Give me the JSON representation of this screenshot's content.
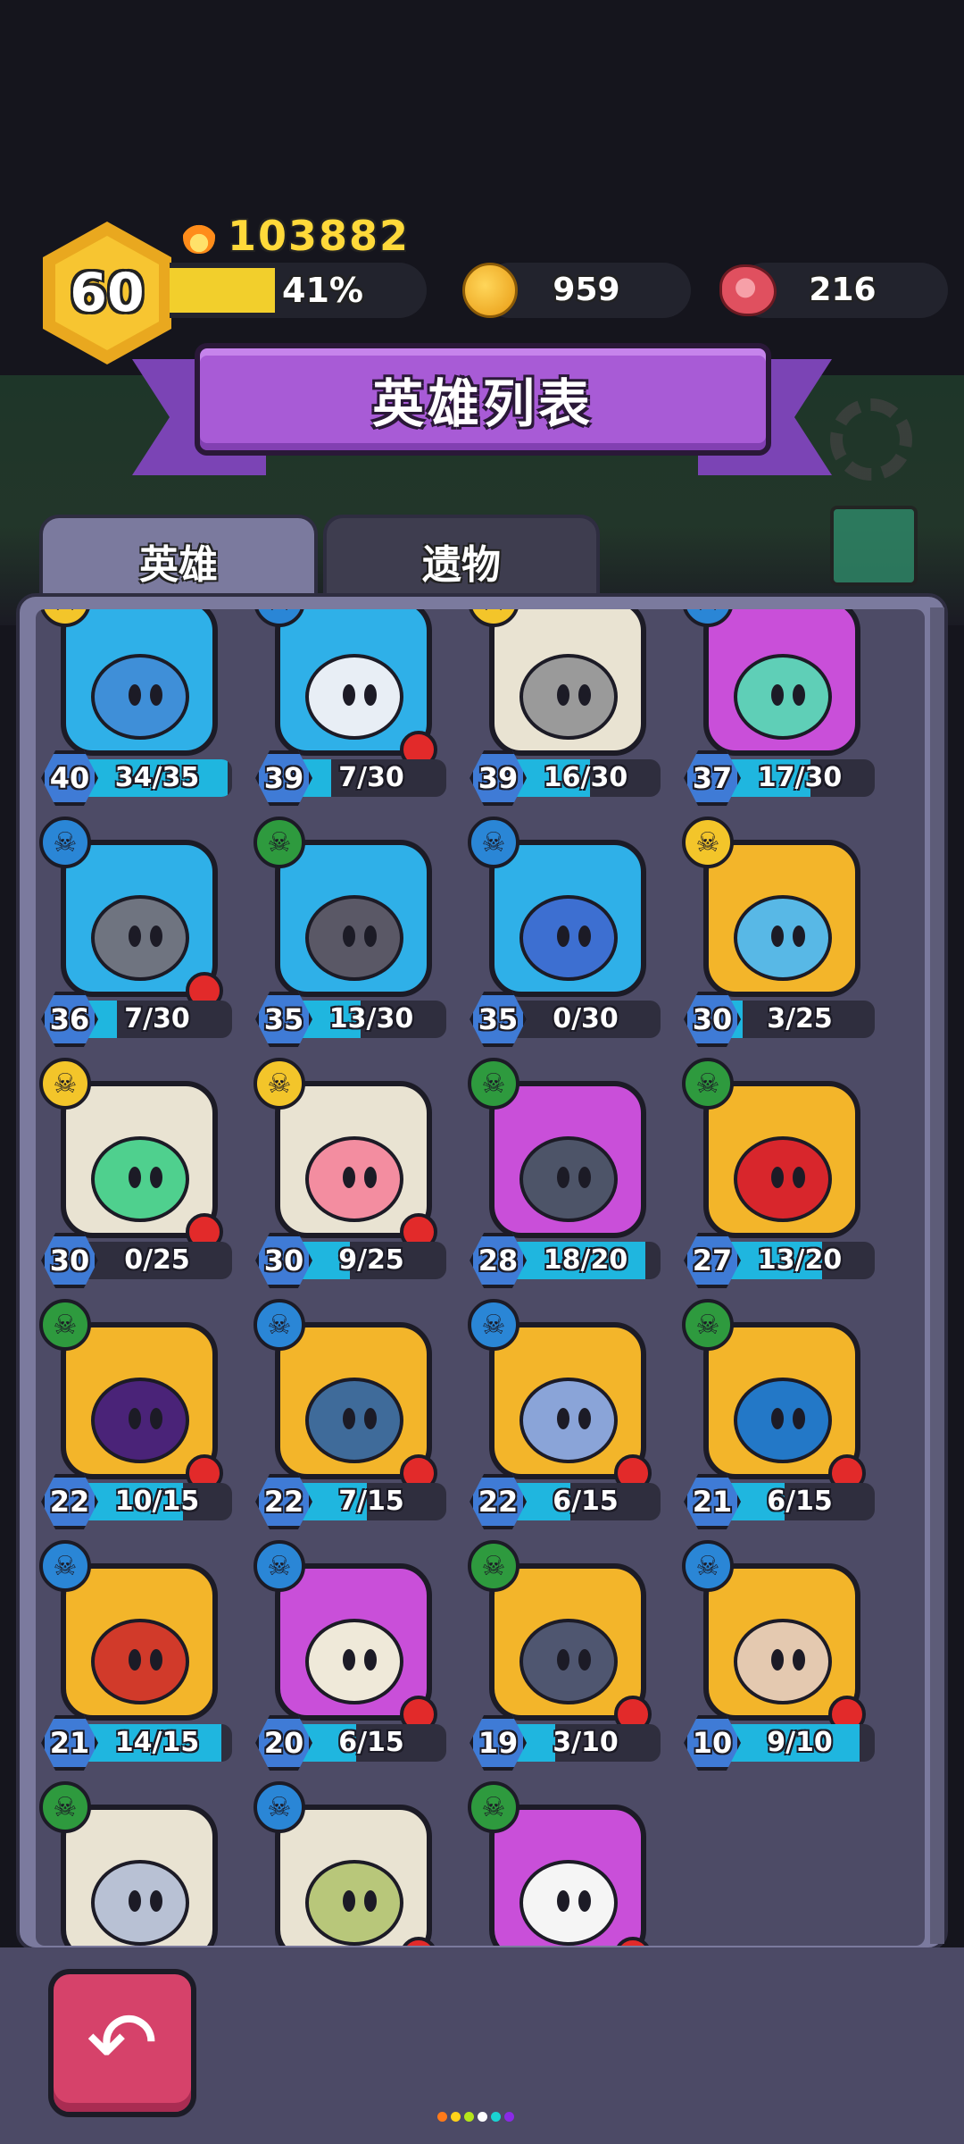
{
  "player": {
    "level": "60",
    "power": "103882",
    "xp_percent_label": "41%",
    "xp_fraction": 0.41
  },
  "resources": {
    "gold": "959",
    "meat": "216"
  },
  "title": "英雄列表",
  "tabs": [
    {
      "label": "英雄",
      "active": true
    },
    {
      "label": "遗物",
      "active": false
    }
  ],
  "heroes": [
    {
      "level": "40",
      "progress": "34/35",
      "fill": 0.97,
      "bg": "#2fb0e8",
      "face": "#3f8fd8",
      "badge": "crossbones",
      "new": false
    },
    {
      "level": "39",
      "progress": "7/30",
      "fill": 0.23,
      "bg": "#2fb0e8",
      "face": "#e8eef5",
      "badge": "blue",
      "new": true
    },
    {
      "level": "39",
      "progress": "16/30",
      "fill": 0.53,
      "bg": "#e9e3d2",
      "face": "#9a9a9a",
      "badge": "crossbones",
      "new": false
    },
    {
      "level": "37",
      "progress": "17/30",
      "fill": 0.57,
      "bg": "#c94fd9",
      "face": "#5fcfb7",
      "badge": "blue",
      "new": false
    },
    {
      "level": "36",
      "progress": "7/30",
      "fill": 0.23,
      "bg": "#2fb0e8",
      "face": "#6f7480",
      "badge": "blue",
      "new": true
    },
    {
      "level": "35",
      "progress": "13/30",
      "fill": 0.43,
      "bg": "#2fb0e8",
      "face": "#5a5866",
      "badge": "green",
      "new": false
    },
    {
      "level": "35",
      "progress": "0/30",
      "fill": 0.0,
      "bg": "#2fb0e8",
      "face": "#3d6fd1",
      "badge": "blue",
      "new": false
    },
    {
      "level": "30",
      "progress": "3/25",
      "fill": 0.12,
      "bg": "#f3b52a",
      "face": "#58b8e6",
      "badge": "crossbones",
      "new": false
    },
    {
      "level": "30",
      "progress": "0/25",
      "fill": 0.0,
      "bg": "#e9e3d2",
      "face": "#4fd08e",
      "badge": "crossbones",
      "new": true
    },
    {
      "level": "30",
      "progress": "9/25",
      "fill": 0.36,
      "bg": "#e9e3d2",
      "face": "#f38da0",
      "badge": "crossbones",
      "new": true
    },
    {
      "level": "28",
      "progress": "18/20",
      "fill": 0.9,
      "bg": "#c94fd9",
      "face": "#4d5468",
      "badge": "green",
      "new": false
    },
    {
      "level": "27",
      "progress": "13/20",
      "fill": 0.65,
      "bg": "#f3b52a",
      "face": "#d8262c",
      "badge": "green",
      "new": false
    },
    {
      "level": "22",
      "progress": "10/15",
      "fill": 0.67,
      "bg": "#f3b52a",
      "face": "#4a2378",
      "badge": "green",
      "new": true
    },
    {
      "level": "22",
      "progress": "7/15",
      "fill": 0.47,
      "bg": "#f3b52a",
      "face": "#3f6b9a",
      "badge": "blue",
      "new": true
    },
    {
      "level": "22",
      "progress": "6/15",
      "fill": 0.4,
      "bg": "#f3b52a",
      "face": "#8aa4d8",
      "badge": "blue",
      "new": true
    },
    {
      "level": "21",
      "progress": "6/15",
      "fill": 0.4,
      "bg": "#f3b52a",
      "face": "#2378c7",
      "badge": "green",
      "new": true
    },
    {
      "level": "21",
      "progress": "14/15",
      "fill": 0.93,
      "bg": "#f3b52a",
      "face": "#d13a2a",
      "badge": "blue",
      "new": false
    },
    {
      "level": "20",
      "progress": "6/15",
      "fill": 0.4,
      "bg": "#c94fd9",
      "face": "#efe9d9",
      "badge": "blue",
      "new": true
    },
    {
      "level": "19",
      "progress": "3/10",
      "fill": 0.3,
      "bg": "#f3b52a",
      "face": "#4f5670",
      "badge": "green",
      "new": true
    },
    {
      "level": "10",
      "progress": "9/10",
      "fill": 0.9,
      "bg": "#f3b52a",
      "face": "#e4c9b0",
      "badge": "blue",
      "new": true
    },
    {
      "level": "",
      "progress": "",
      "fill": 0.0,
      "bg": "#e9e3d2",
      "face": "#b8c1d4",
      "badge": "green",
      "new": false
    },
    {
      "level": "",
      "progress": "",
      "fill": 0.0,
      "bg": "#e9e3d2",
      "face": "#b8c77a",
      "badge": "blue",
      "new": true
    },
    {
      "level": "",
      "progress": "",
      "fill": 0.0,
      "bg": "#c94fd9",
      "face": "#f5f5f5",
      "badge": "green",
      "new": true
    }
  ],
  "colors": {
    "progress_fill": "#1fb6df",
    "accent_purple": "#a85bd6",
    "back_button": "#d6426a",
    "badge_blue": "#2a86d6",
    "badge_green": "#2e9a3e",
    "badge_crossbones": "#f3c52a"
  },
  "page_dots": [
    "#ff7a1a",
    "#ffd21a",
    "#b5e61a",
    "#ffffff",
    "#1ad2d2",
    "#8a2ae6"
  ]
}
